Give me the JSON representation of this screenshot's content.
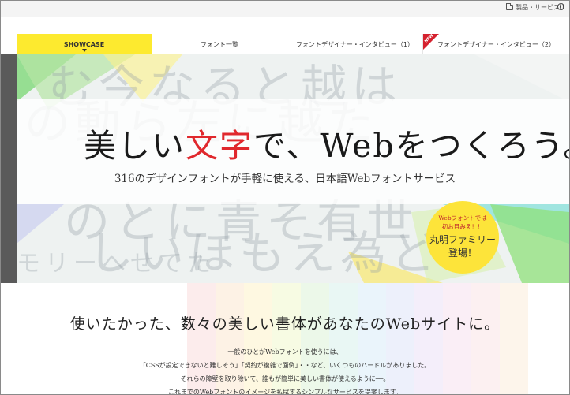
{
  "topbar": {
    "products_label": "製品・サービス",
    "products_icon": "folder-icon",
    "lang_icon": "globe-icon"
  },
  "nav": {
    "tabs": [
      {
        "label": "SHOWCASE",
        "active": true
      },
      {
        "label": "フォント一覧",
        "active": false
      },
      {
        "label": "フォントデザイナー・インタビュー（1）",
        "active": false
      },
      {
        "label": "フォントデザイナー・インタビュー（2）",
        "active": false,
        "badge": "NEW"
      }
    ]
  },
  "hero": {
    "headline_part1": "美しい",
    "headline_red": "文字",
    "headline_part2": "で、Webをつくろう。",
    "subline": "316のデザインフォントが手軽に使える、日本語Webフォントサービス",
    "badge": {
      "line1": "Webフォントでは",
      "line2": "初お目みえ！！",
      "line3": "丸明ファミリー",
      "line4": "登場！"
    },
    "bg_text": {
      "row1": "む今なると越は",
      "row2": "の動ら左に越た",
      "row3": "のとに青そ有世",
      "row4": "しいほもえ為ど",
      "row5": "モリーへせてた"
    }
  },
  "lower": {
    "title": "使いたかった、数々の美しい書体があなたのWebサイトに。",
    "paragraphs": [
      "一般のひとがWebフォントを使うには、",
      "「CSSが設定できないと難しそう」「契約が複雑で面倒」・・など、いくつものハードルがありました。",
      "それらの障壁を取り除いて、誰もが簡単に美しい書体が使えるように──。",
      "これまでのWebフォントのイメージを払拭するシンプルなサービスを提案します。"
    ]
  },
  "colors": {
    "accent_yellow": "#fdea2f",
    "accent_red": "#e0282d",
    "badge_yellow": "#fde43a"
  }
}
